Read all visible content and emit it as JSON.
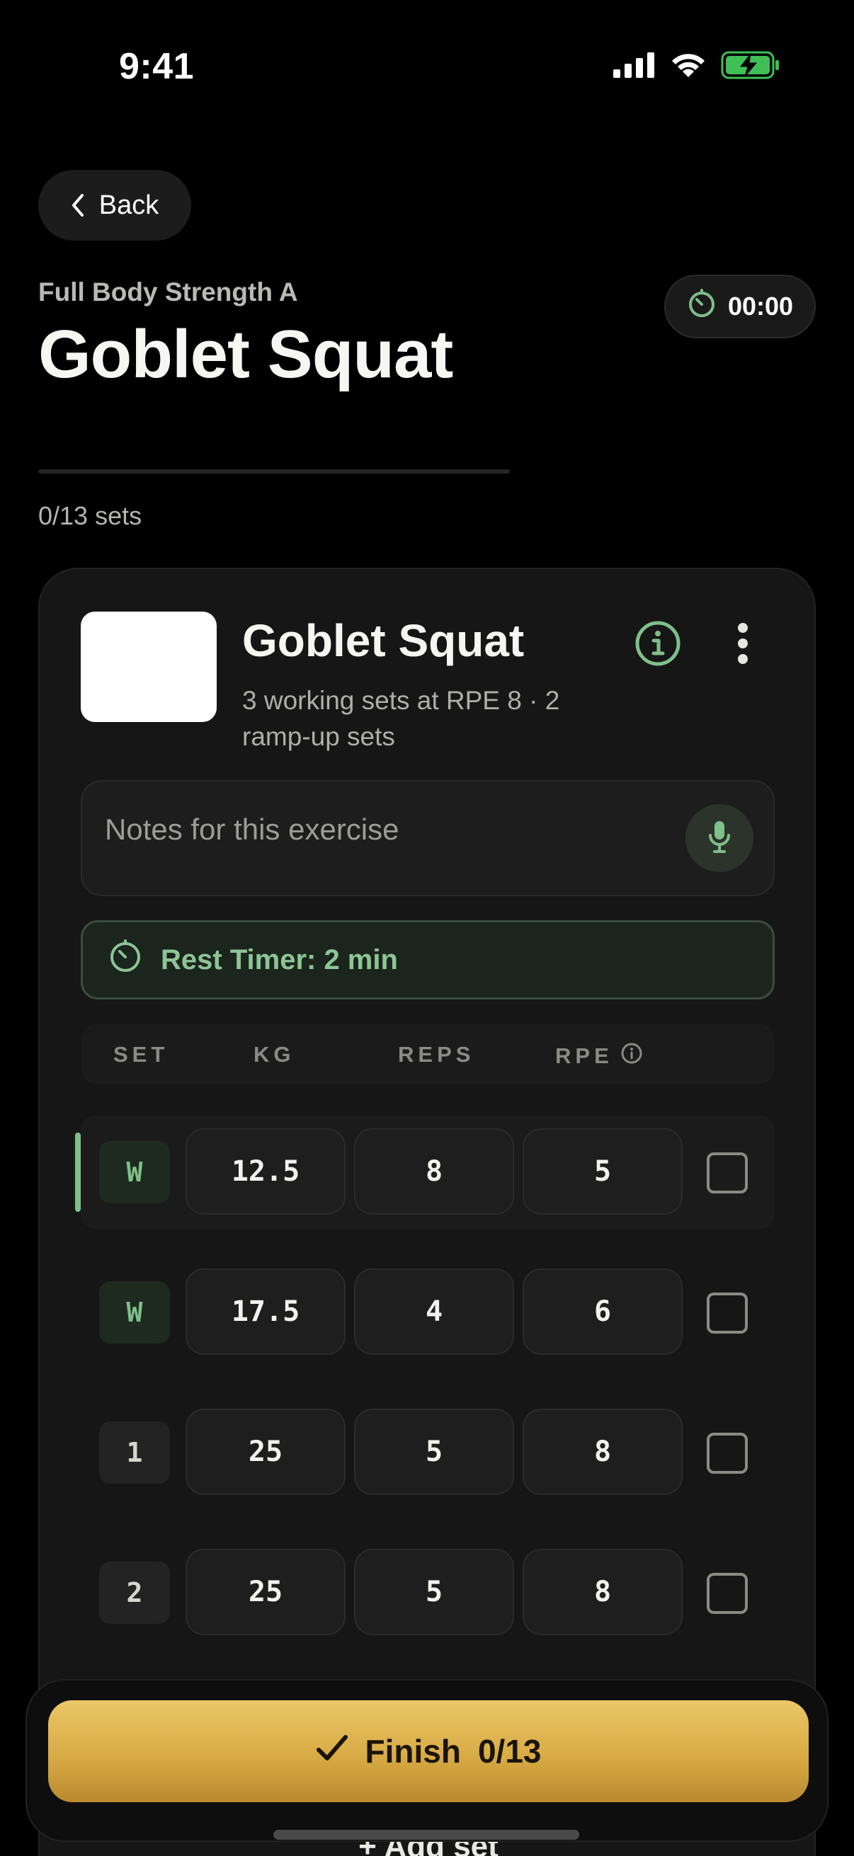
{
  "status_bar": {
    "time": "9:41"
  },
  "nav": {
    "back_label": "Back"
  },
  "header": {
    "workout_name": "Full Body Strength A",
    "exercise_title": "Goblet Squat",
    "timer": "00:00"
  },
  "progress": {
    "label": "0/13 sets",
    "fraction": 0
  },
  "exercise": {
    "name": "Goblet Squat",
    "description": "3 working sets at RPE 8 · 2 ramp-up sets",
    "notes_placeholder": "Notes for this exercise",
    "rest_timer": "Rest Timer: 2 min"
  },
  "table": {
    "headers": {
      "set": "SET",
      "kg": "KG",
      "reps": "REPS",
      "rpe": "RPE"
    },
    "rows": [
      {
        "set": "W",
        "kg": "12.5",
        "reps": "8",
        "rpe": "5",
        "type": "warmup",
        "active": true,
        "done": false
      },
      {
        "set": "W",
        "kg": "17.5",
        "reps": "4",
        "rpe": "6",
        "type": "warmup",
        "active": false,
        "done": false
      },
      {
        "set": "1",
        "kg": "25",
        "reps": "5",
        "rpe": "8",
        "type": "working",
        "active": false,
        "done": false
      },
      {
        "set": "2",
        "kg": "25",
        "reps": "5",
        "rpe": "8",
        "type": "working",
        "active": false,
        "done": false
      }
    ]
  },
  "add_set_label": "+ Add set",
  "finish": {
    "label": "Finish",
    "count": "0/13"
  },
  "colors": {
    "accent_green": "#7fbf89",
    "accent_gold": "#d8ab45",
    "background": "#000000"
  }
}
